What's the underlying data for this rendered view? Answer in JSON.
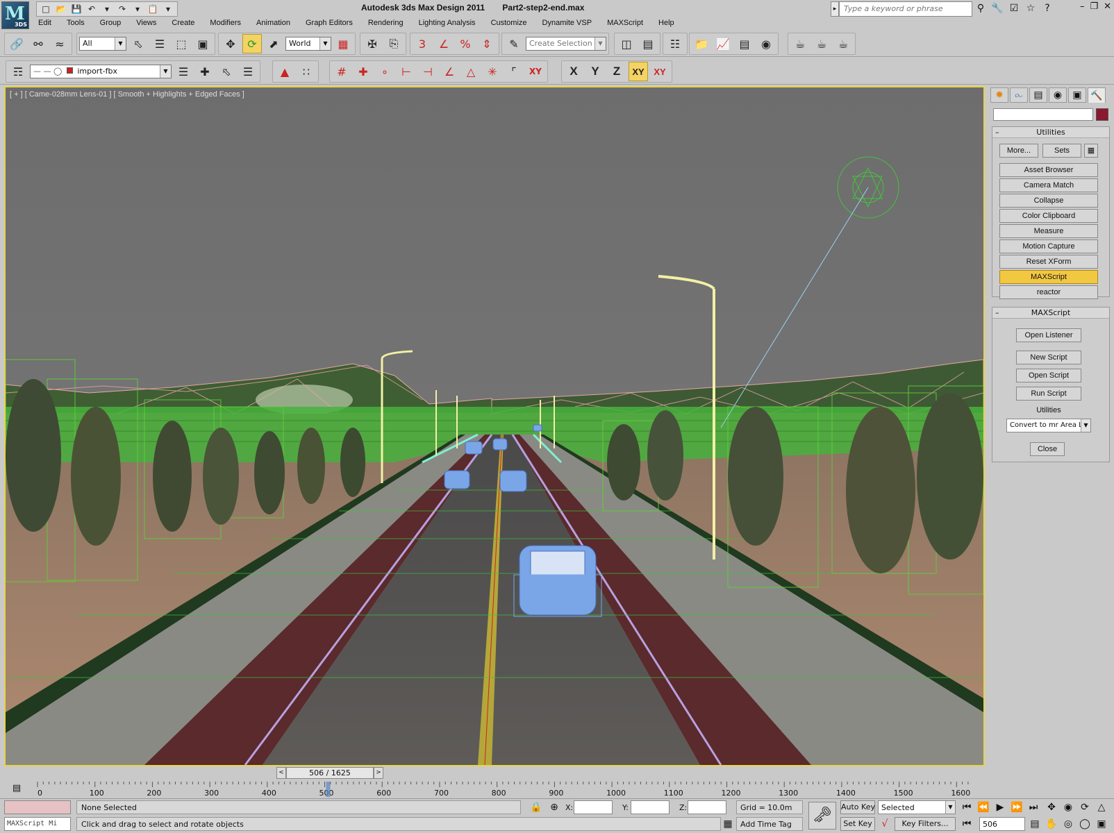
{
  "titlebar": {
    "app_logo_text": "3DS",
    "app_name": "Autodesk 3ds Max Design 2011",
    "file_name": "Part2-step2-end.max",
    "search_placeholder": "Type a keyword or phrase"
  },
  "menu": [
    "Edit",
    "Tools",
    "Group",
    "Views",
    "Create",
    "Modifiers",
    "Animation",
    "Graph Editors",
    "Rendering",
    "Lighting Analysis",
    "Customize",
    "Dynamite VSP",
    "MAXScript",
    "Help"
  ],
  "toolbar": {
    "selection_filter": "All",
    "reference_coord": "World",
    "named_selection_placeholder": "Create Selection Se",
    "snap_toggle_label": "3",
    "layer_name": "import-fbx",
    "axis_x": "X",
    "axis_y": "Y",
    "axis_z": "Z",
    "axis_xy": "XY",
    "axis_xy2": "XY"
  },
  "viewport": {
    "label": "[ + ] [ Came-028mm Lens-01 ] [ Smooth + Highlights + Edged Faces ]"
  },
  "command_panel": {
    "utilities_title": "Utilities",
    "more_label": "More...",
    "sets_label": "Sets",
    "utility_buttons": [
      "Asset Browser",
      "Camera Match",
      "Collapse",
      "Color Clipboard",
      "Measure",
      "Motion Capture",
      "Reset XForm",
      "MAXScript",
      "reactor"
    ],
    "active_utility": "MAXScript",
    "maxscript_title": "MAXScript",
    "open_listener": "Open Listener",
    "new_script": "New Script",
    "open_script": "Open Script",
    "run_script": "Run Script",
    "utilities_label": "Utilities",
    "utility_dropdown": "Convert to mr Area Li",
    "close_label": "Close"
  },
  "timeline": {
    "current_frame": 506,
    "total_frames": 1625,
    "slider_text": "506 / 1625",
    "ticks": [
      "0",
      "100",
      "200",
      "300",
      "400",
      "500",
      "600",
      "700",
      "800",
      "900",
      "1000",
      "1100",
      "1200",
      "1300",
      "1400",
      "1500",
      "1600"
    ]
  },
  "status": {
    "maxscript_listener": "MAXScript Mi",
    "selection_status": "None Selected",
    "prompt": "Click and drag to select and rotate objects",
    "x_label": "X:",
    "y_label": "Y:",
    "z_label": "Z:",
    "grid": "Grid = 10.0m",
    "add_time_tag": "Add Time Tag",
    "auto_key": "Auto Key",
    "set_key": "Set Key",
    "selected_dd": "Selected",
    "key_filters": "Key Filters...",
    "frame_field": "506"
  },
  "colors": {
    "viewport_border": "#e8d34a",
    "active_button": "#f2c842",
    "sky": "#6f6f6f",
    "wireframe_green": "#3cc23c",
    "car_blue": "#7aa6e8"
  }
}
